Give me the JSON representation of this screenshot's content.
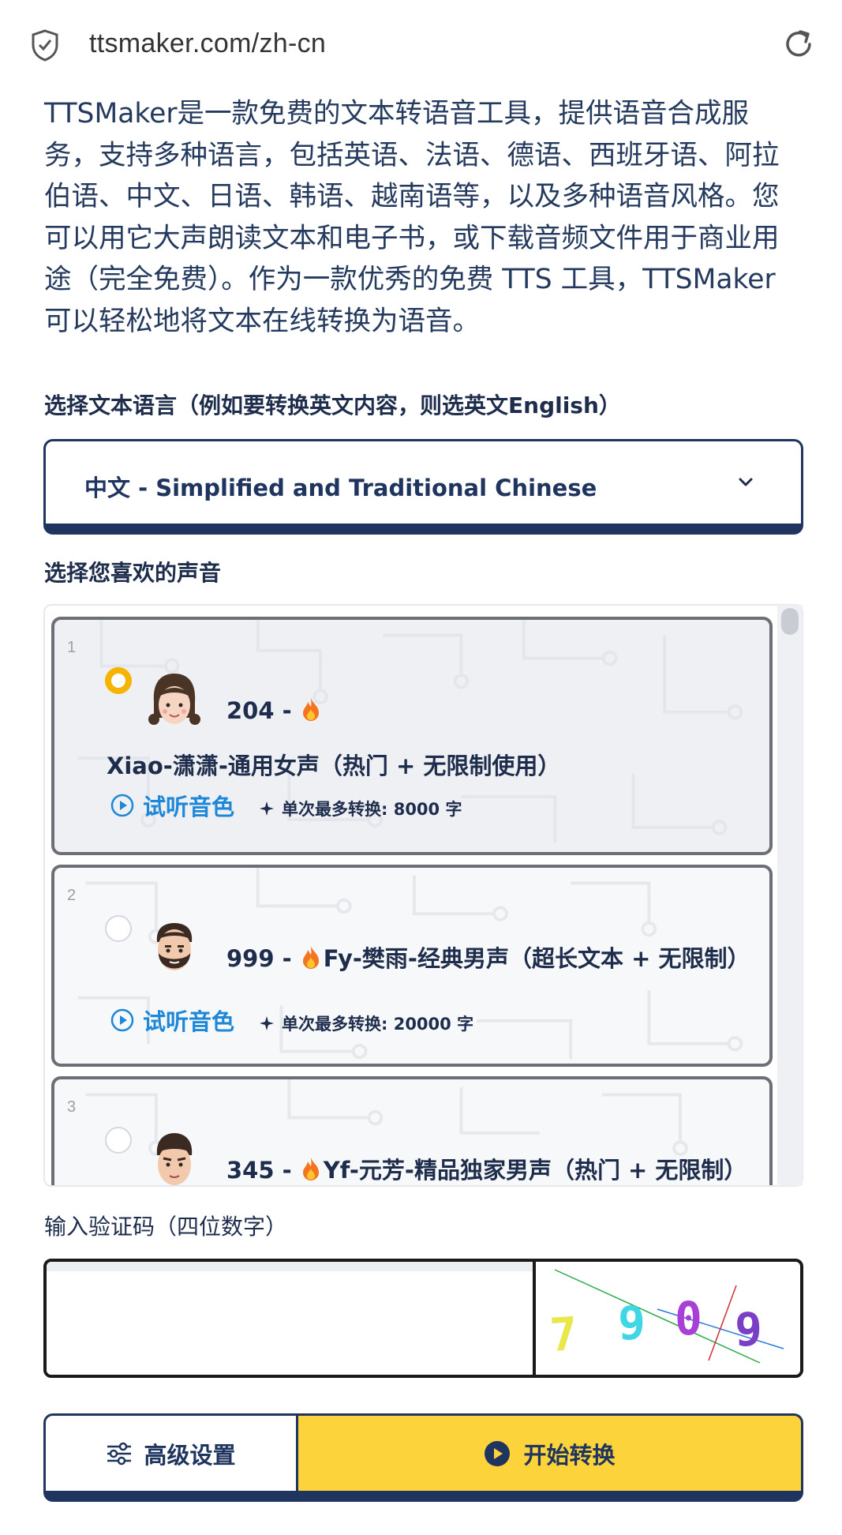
{
  "browser": {
    "url": "ttsmaker.com/zh-cn",
    "icons": [
      "shield-check-icon",
      "reload-icon"
    ]
  },
  "intro": {
    "text": "TTSMaker是一款免费的文本转语音工具，提供语音合成服务，支持多种语言，包括英语、法语、德语、西班牙语、阿拉伯语、中文、日语、韩语、越南语等，以及多种语音风格。您可以用它大声朗读文本和电子书，或下载音频文件用于商业用途（完全免费）。作为一款优秀的免费 TTS 工具，TTSMaker 可以轻松地将文本在线转换为语音。"
  },
  "language": {
    "label": "选择文本语言（例如要转换英文内容，则选英文English）",
    "selected": "中文 - Simplified and Traditional Chinese"
  },
  "voices": {
    "label": "选择您喜欢的声音",
    "listen_label": "试听音色",
    "items": [
      {
        "index": "1",
        "title": "204 - Xiao-潇潇-通用女声（热门 + 无限制使用）",
        "max": "单次最多转换: 8000 字",
        "selected": true,
        "avatar": "woman-avatar-icon"
      },
      {
        "index": "2",
        "title": "999 - Fy-樊雨-经典男声（超长文本 + 无限制）",
        "max": "单次最多转换: 20000 字",
        "selected": false,
        "avatar": "bearded-man-avatar-icon"
      },
      {
        "index": "3",
        "title": "345 - Yf-元芳-精品独家男声（热门 + 无限制）",
        "max": "",
        "selected": false,
        "avatar": "man-avatar-icon"
      }
    ]
  },
  "captcha": {
    "label": "输入验证码（四位数字）",
    "value": "",
    "image_digits": "7909"
  },
  "actions": {
    "advanced_label": "高级设置",
    "start_label": "开始转换"
  },
  "colors": {
    "navy": "#1f3560",
    "yellow": "#fdd33c",
    "link_blue": "#1e88d8",
    "radio_selected": "#f5b400"
  }
}
